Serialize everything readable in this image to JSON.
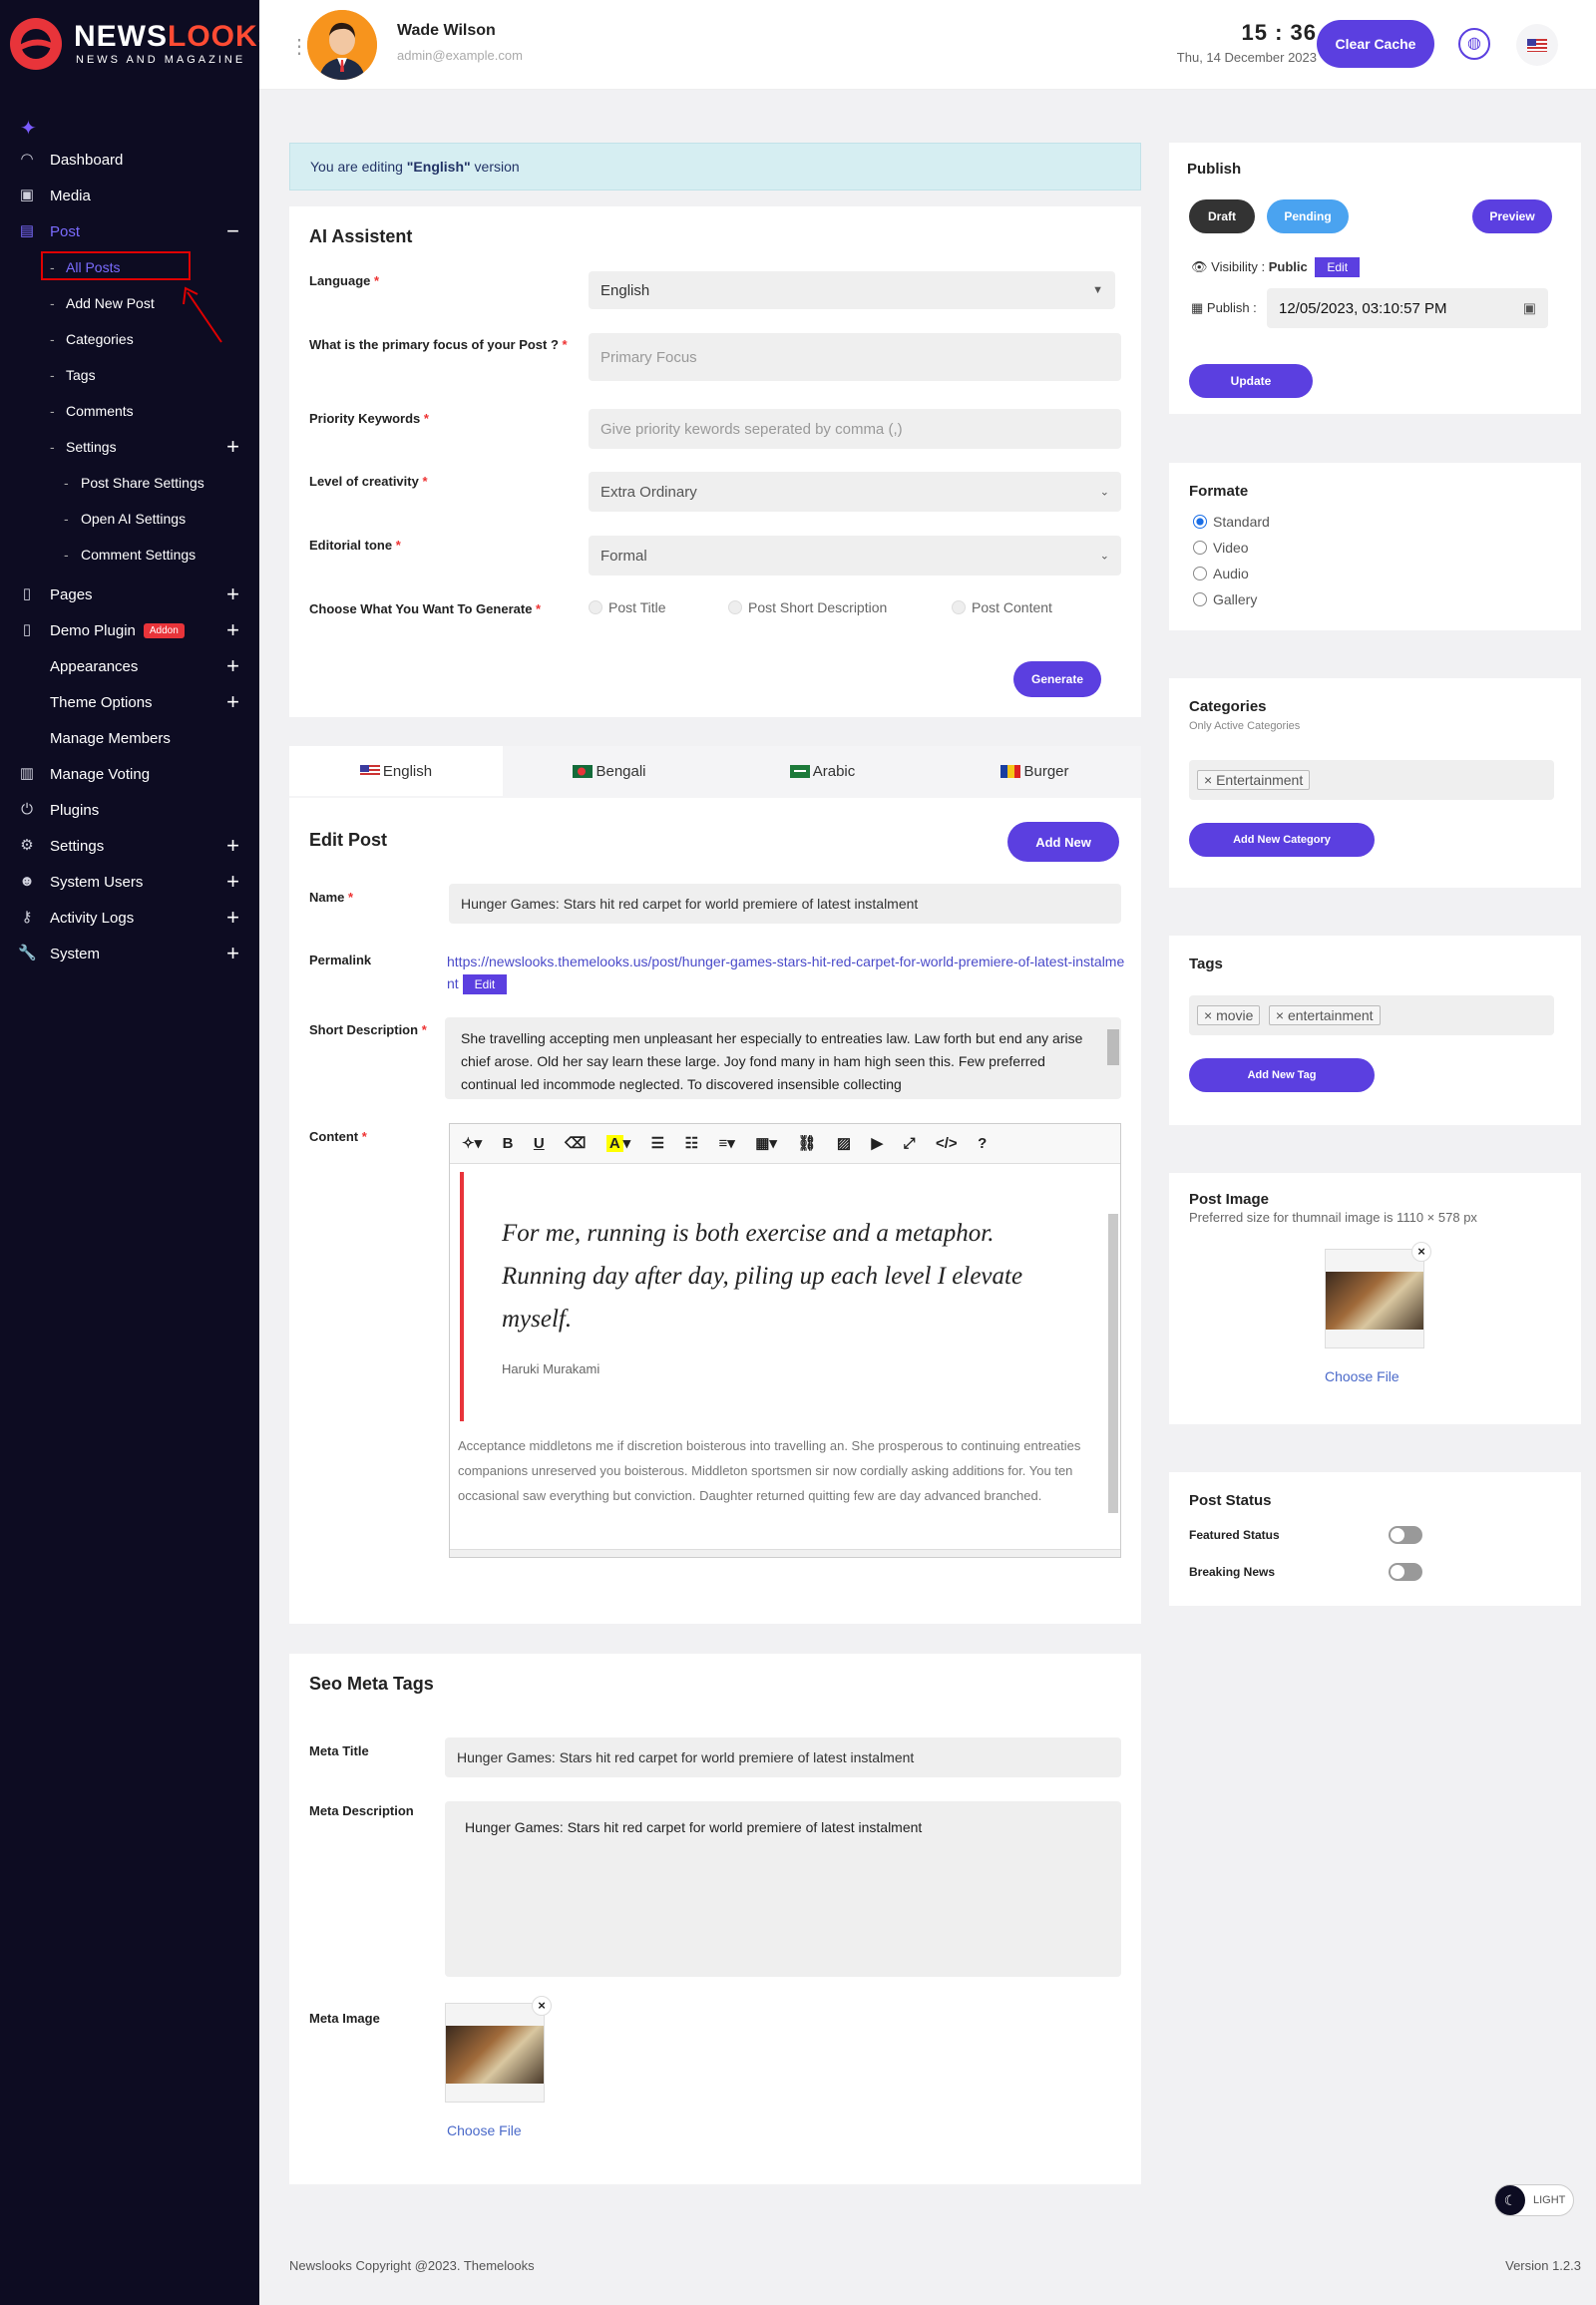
{
  "brand": {
    "name_part1": "NEWS",
    "name_part2": "LOOKS",
    "tagline": "NEWS AND MAGAZINE"
  },
  "sidebar": {
    "items": [
      {
        "label": "Dashboard",
        "icon": "gauge-icon"
      },
      {
        "label": "Media",
        "icon": "images-icon"
      },
      {
        "label": "Post",
        "icon": "post-icon",
        "expanded": true
      },
      {
        "label": "All Posts"
      },
      {
        "label": "Add New Post"
      },
      {
        "label": "Categories"
      },
      {
        "label": "Tags"
      },
      {
        "label": "Comments"
      },
      {
        "label": "Settings"
      },
      {
        "label": "Post Share Settings"
      },
      {
        "label": "Open AI Settings"
      },
      {
        "label": "Comment Settings"
      },
      {
        "label": "Pages",
        "icon": "file-icon"
      },
      {
        "label": "Demo Plugin",
        "icon": "file-icon",
        "badge": "Addon"
      },
      {
        "label": "Appearances"
      },
      {
        "label": "Theme Options"
      },
      {
        "label": "Manage Members"
      },
      {
        "label": "Manage Voting",
        "icon": "chart-icon"
      },
      {
        "label": "Plugins",
        "icon": "power-icon"
      },
      {
        "label": "Settings",
        "icon": "gears-icon"
      },
      {
        "label": "System Users",
        "icon": "users-icon"
      },
      {
        "label": "Activity Logs",
        "icon": "key-icon"
      },
      {
        "label": "System",
        "icon": "wrench-icon"
      }
    ]
  },
  "topbar": {
    "user_name": "Wade Wilson",
    "user_email": "admin@example.com",
    "time": "15 : 36",
    "date": "Thu, 14 December 2023",
    "clear_cache": "Clear Cache"
  },
  "notice": {
    "prefix": "You are editing ",
    "lang": "\"English\"",
    "suffix": " version"
  },
  "ai": {
    "title": "AI Assistent",
    "language_label": "Language",
    "language_value": "English",
    "focus_label": "What is the primary focus of your Post ?",
    "focus_placeholder": "Primary Focus",
    "keywords_label": "Priority Keywords",
    "keywords_placeholder": "Give priority kewords seperated by comma (,)",
    "creativity_label": "Level of creativity",
    "creativity_value": "Extra Ordinary",
    "tone_label": "Editorial tone",
    "tone_value": "Formal",
    "generate_label": "Choose What You Want To Generate",
    "options": [
      "Post Title",
      "Post Short Description",
      "Post Content"
    ],
    "generate_btn": "Generate"
  },
  "lang_tabs": [
    "English",
    "Bengali",
    "Arabic",
    "Burger"
  ],
  "edit_post": {
    "title": "Edit Post",
    "add_new": "Add New",
    "name_label": "Name",
    "name_value": "Hunger Games: Stars hit red carpet for world premiere of latest instalment",
    "permalink_label": "Permalink",
    "permalink_value": "https://newslooks.themelooks.us/post/hunger-games-stars-hit-red-carpet-for-world-premiere-of-latest-instalment",
    "edit_btn": "Edit",
    "short_desc_label": "Short Description",
    "short_desc_value": "She travelling accepting men unpleasant her especially to entreaties law. Law forth but end any arise chief arose. Old her say learn these large. Joy fond many in ham high seen this. Few preferred continual led incommode neglected. To discovered insensible collecting",
    "content_label": "Content",
    "quote": "For me, running is both exercise and a metaphor. Running day after day, piling up each level I elevate myself.",
    "quote_author": "Haruki Murakami",
    "body": "Acceptance middletons me if discretion boisterous into travelling an. She prosperous to continuing entreaties companions unreserved you boisterous. Middleton sportsmen sir now cordially asking additions for. You ten occasional saw everything but conviction. Daughter returned quitting few are day advanced branched."
  },
  "seo": {
    "title": "Seo Meta Tags",
    "meta_title_label": "Meta Title",
    "meta_title_value": "Hunger Games: Stars hit red carpet for world premiere of latest instalment",
    "meta_desc_label": "Meta Description",
    "meta_desc_value": "Hunger Games: Stars hit red carpet for world premiere of latest instalment",
    "meta_image_label": "Meta Image",
    "choose_file": "Choose File"
  },
  "publish": {
    "title": "Publish",
    "draft": "Draft",
    "pending": "Pending",
    "preview": "Preview",
    "visibility_label": "Visibility :",
    "visibility_value": "Public",
    "edit": "Edit",
    "publish_label": "Publish :",
    "publish_value": "12/05/2023, 03:10:57 PM",
    "update": "Update"
  },
  "format": {
    "title": "Formate",
    "options": [
      "Standard",
      "Video",
      "Audio",
      "Gallery"
    ],
    "selected": "Standard"
  },
  "categories": {
    "title": "Categories",
    "subtitle": "Only Active Categories",
    "chips": [
      "Entertainment"
    ],
    "add_btn": "Add New Category"
  },
  "tags": {
    "title": "Tags",
    "chips": [
      "movie",
      "entertainment"
    ],
    "add_btn": "Add New Tag"
  },
  "post_image": {
    "title": "Post Image",
    "subtitle": "Preferred size for thumnail image is 1110 × 578 px",
    "choose_file": "Choose File"
  },
  "post_status": {
    "title": "Post Status",
    "featured": "Featured Status",
    "breaking": "Breaking News"
  },
  "footer": {
    "copyright": "Newslooks Copyright @2023. Themelooks",
    "version": "Version 1.2.3",
    "light": "LIGHT"
  },
  "colors": {
    "primary": "#5b3fe0",
    "sidebar": "#0d0c22",
    "accent": "#ff4b33",
    "pending": "#4aa3f0"
  }
}
